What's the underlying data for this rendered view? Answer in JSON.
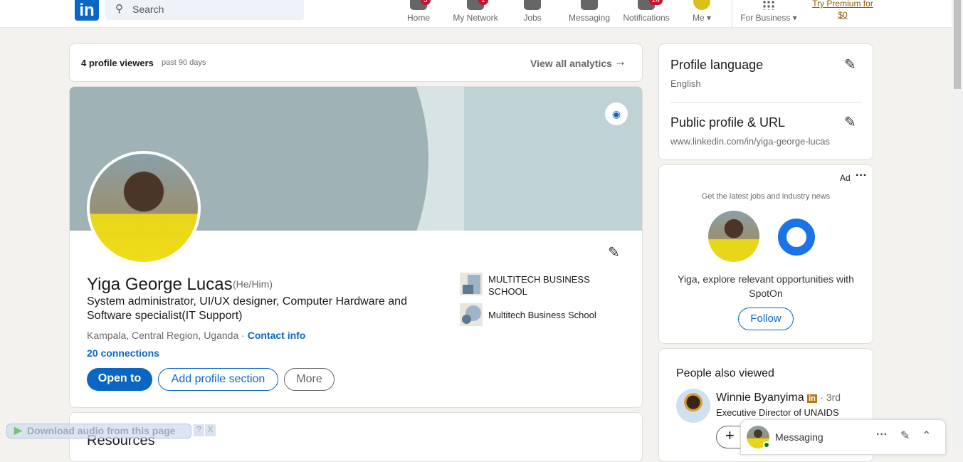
{
  "header": {
    "search_placeholder": "Search",
    "nav": [
      {
        "label": "Home",
        "badge": "3"
      },
      {
        "label": "My Network",
        "badge": "1"
      },
      {
        "label": "Jobs"
      },
      {
        "label": "Messaging"
      },
      {
        "label": "Notifications",
        "badge": "24"
      },
      {
        "label": "Me"
      }
    ],
    "for_business": "For Business",
    "premium_line1": "Try Premium for",
    "premium_line2": "$0"
  },
  "viewers": {
    "count": "4 profile viewers",
    "period": "past 90 days",
    "analytics": "View all analytics"
  },
  "profile": {
    "name": "Yiga George Lucas",
    "pronouns": "(He/Him)",
    "headline": "System administrator, UI/UX designer, Computer Hardware and Software specialist(IT Support)",
    "location": "Kampala, Central Region, Uganda",
    "contact": "Contact info",
    "connections": "20 connections",
    "open_to": "Open to",
    "add_section": "Add profile section",
    "more": "More",
    "orgs": [
      "MULTITECH BUSINESS SCHOOL",
      "Multitech Business School"
    ]
  },
  "resources": {
    "title": "Resources"
  },
  "sidebar": {
    "lang_title": "Profile language",
    "lang_value": "English",
    "url_title": "Public profile & URL",
    "url_value": "www.linkedin.com/in/yiga-george-lucas"
  },
  "ad": {
    "label": "Ad",
    "tagline": "Get the latest jobs and industry news",
    "text": "Yiga, explore relevant opportunities with SpotOn",
    "follow": "Follow"
  },
  "people": {
    "title": "People also viewed",
    "items": [
      {
        "name": "Winnie Byanyima",
        "degree": "· 3rd",
        "headline": "Executive Director of UNAIDS"
      }
    ]
  },
  "messaging": {
    "label": "Messaging"
  },
  "plugin": {
    "label": "Download audio from this page"
  },
  "colors": {
    "brand": "#0a66c2"
  }
}
